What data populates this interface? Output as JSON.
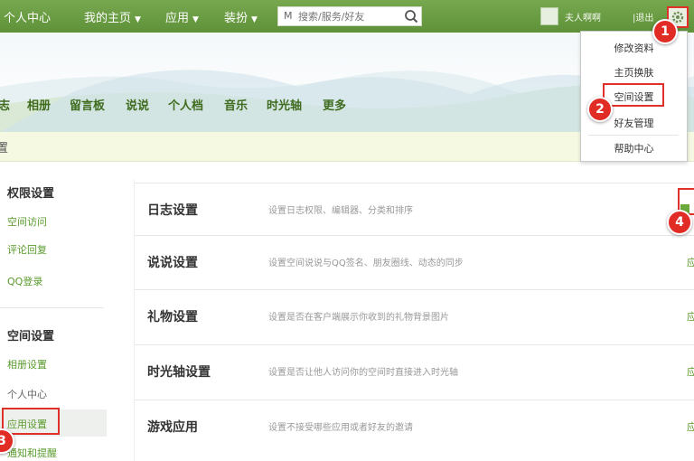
{
  "topnav": {
    "items": [
      "个人中心",
      "我的主页",
      "应用",
      "装扮"
    ],
    "search_prefix": "M",
    "search_placeholder": "搜索/服务/好友",
    "user_name": "夫人啊啊",
    "logout": "|退出"
  },
  "tabs": [
    "志",
    "相册",
    "留言板",
    "说说",
    "个人档",
    "音乐",
    "时光轴",
    "更多"
  ],
  "notice": "置",
  "dropdown": {
    "items": [
      "修改资料",
      "主页换肤",
      "空间设置",
      "好友管理",
      "帮助中心"
    ]
  },
  "sidebar": {
    "groups": [
      {
        "heading": "权限设置",
        "items": [
          "空间访问",
          "评论回复",
          "QQ登录"
        ]
      },
      {
        "heading": "空间设置",
        "items": [
          "相册设置",
          "个人中心",
          "应用设置",
          "通知和提醒"
        ]
      }
    ]
  },
  "settings_rows": [
    {
      "title": "日志设置",
      "desc": "设置日志权限、编辑器、分类和排序",
      "action": ""
    },
    {
      "title": "说说设置",
      "desc": "设置空间说说与QQ签名、朋友圈线、动态的同步",
      "action": "应"
    },
    {
      "title": "礼物设置",
      "desc": "设置是否在客户端展示你收到的礼物背景图片",
      "action": "应"
    },
    {
      "title": "时光轴设置",
      "desc": "设置是否让他人访问你的空间时直接进入时光轴",
      "action": "应"
    },
    {
      "title": "游戏应用",
      "desc": "设置不接受哪些应用或者好友的邀请",
      "action": "应"
    }
  ],
  "markers": [
    "1",
    "2",
    "3",
    "4"
  ],
  "colors": {
    "topbar": "#6a9c45",
    "accent_green": "#5a9a2c",
    "highlight_red": "#e0302a",
    "notice_bg": "#f5f9e2"
  }
}
